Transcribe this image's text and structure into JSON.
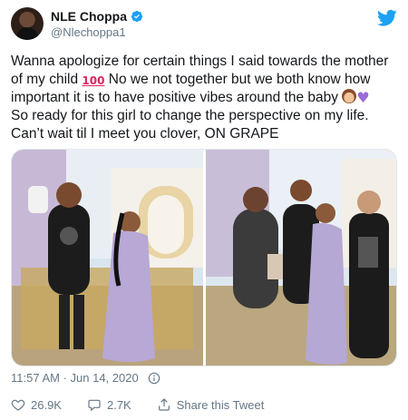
{
  "user": {
    "display_name": "NLE Choppa",
    "handle": "@Nlechoppa1",
    "avatar_icon": "avatar",
    "verified_icon": "verified-badge-icon",
    "verified_color": "#1da1f2"
  },
  "logo_icon": "twitter-bird-icon",
  "tweet": {
    "lines": [
      "Wanna apologize for certain things I said towards the mother",
      "of my child",
      "No we not together but we both know how",
      "important it is to have positive vibes around the baby",
      "So ready for this girl to change the perspective on my life.",
      "Can’t wait til I meet you clover, ON GRAPE"
    ],
    "emoji_100": "100",
    "emoji_girl": "girl-emoji",
    "emoji_heart": "♥"
  },
  "media": {
    "left_photo": "baby-shower-couple-photo",
    "right_photo": "baby-shower-family-photo"
  },
  "meta": {
    "timestamp": "11:57 AM · Jun 14, 2020",
    "info_icon": "info-icon"
  },
  "actions": {
    "likes": "26.9K",
    "replies": "2.7K",
    "share_label": "Share this Tweet"
  },
  "colors": {
    "text": "#14171a",
    "secondary": "#657786",
    "brand": "#1da1f2",
    "emoji_100": "#e0245e",
    "heart": "#9b6bd6"
  }
}
